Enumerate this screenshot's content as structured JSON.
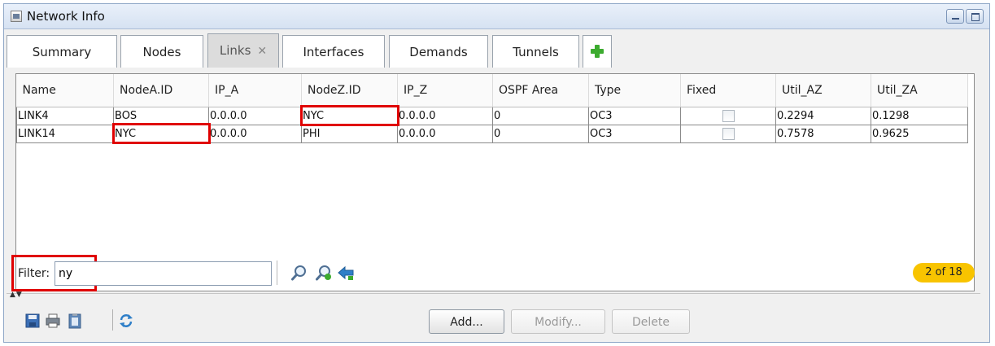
{
  "window": {
    "title": "Network Info"
  },
  "tabs": [
    {
      "label": "Summary"
    },
    {
      "label": "Nodes"
    },
    {
      "label": "Links",
      "close": "✕"
    },
    {
      "label": "Interfaces"
    },
    {
      "label": "Demands"
    },
    {
      "label": "Tunnels"
    }
  ],
  "table": {
    "columns": [
      "Name",
      "NodeA.ID",
      "IP_A",
      "NodeZ.ID",
      "IP_Z",
      "OSPF Area",
      "Type",
      "Fixed",
      "Util_AZ",
      "Util_ZA"
    ],
    "rows": [
      {
        "name": "LINK4",
        "nodeA": "BOS",
        "ipA": "0.0.0.0",
        "nodeZ": "NYC",
        "ipZ": "0.0.0.0",
        "ospf": "0",
        "type": "OC3",
        "fixed": false,
        "utilAZ": "0.2294",
        "utilZA": "0.1298"
      },
      {
        "name": "LINK14",
        "nodeA": "NYC",
        "ipA": "0.0.0.0",
        "nodeZ": "PHI",
        "ipZ": "0.0.0.0",
        "ospf": "0",
        "type": "OC3",
        "fixed": false,
        "utilAZ": "0.7578",
        "utilZA": "0.9625"
      }
    ]
  },
  "filter": {
    "label": "Filter:",
    "value": "ny",
    "count": "2 of 18"
  },
  "buttons": {
    "add": "Add...",
    "modify": "Modify...",
    "delete": "Delete"
  },
  "colors": {
    "highlight": "#e00000",
    "badge": "#f8c400",
    "plus": "#3cab2f"
  },
  "icons": [
    "save-icon",
    "print-icon",
    "clipboard-icon",
    "refresh-icon",
    "search-icon",
    "zoom-to-icon",
    "back-arrow-icon",
    "add-tab-icon"
  ]
}
